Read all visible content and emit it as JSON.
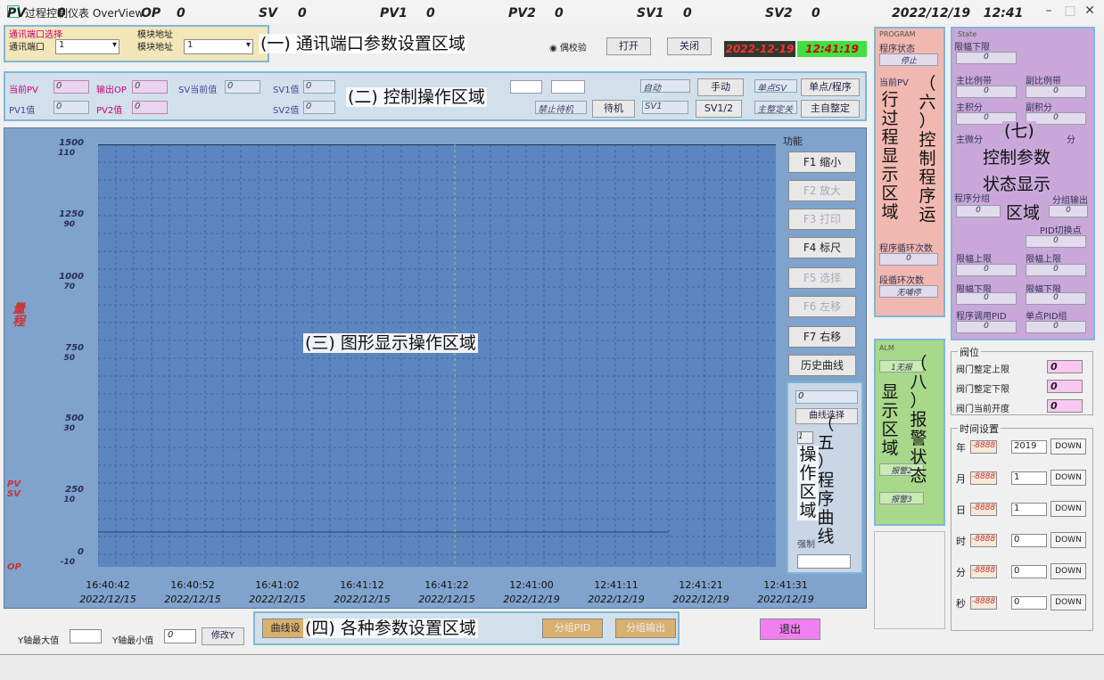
{
  "window": {
    "title": "过程控制仪表  OverView"
  },
  "region_labels": {
    "r1": "(一) 通讯端口参数设置区域",
    "r2": "(二) 控制操作区域",
    "r3": "(三) 图形显示操作区域",
    "r4": "(四) 各种参数设置区域",
    "r5": [
      "（",
      "五",
      "）",
      "程",
      "序",
      "曲",
      "线"
    ],
    "r5b": [
      "操",
      "作",
      "区",
      "域"
    ],
    "r6a": [
      "（",
      "六",
      "）",
      "控",
      "制",
      "程",
      "序",
      "运"
    ],
    "r6b": [
      "行",
      "过",
      "程",
      "显",
      "示",
      "区",
      "域"
    ],
    "r7a": "(七)",
    "r7b": "控制参数",
    "r7c": "状态显示",
    "r7d": "区域",
    "r8a": [
      "（",
      "八",
      "）",
      "报",
      "警",
      "状",
      "态"
    ],
    "r8b": [
      "显",
      "示",
      "区",
      "域"
    ]
  },
  "comm": {
    "port_group": "通讯端口选择",
    "port_label": "通讯端口",
    "port_value": "1",
    "addr_group": "模块地址",
    "addr_label": "模块地址",
    "addr_value": "1",
    "parity_option": "偶校验",
    "open_button": "打开",
    "close_button": "关闭",
    "date": "2022-12-19",
    "time": "12:41:19"
  },
  "control": {
    "pv_label": "当前PV",
    "pv_value": "0",
    "op_label": "输出OP",
    "op_value": "0",
    "sv_label": "SV当前值",
    "sv_value": "0",
    "sv1_label": "SV1值",
    "sv1_value": "0",
    "pv1_label": "PV1值",
    "pv1_value": "0",
    "pv2_label": "PV2值",
    "pv2_value": "0",
    "sv2_label": "SV2值",
    "sv2_value": "0",
    "mode_auto": "自动",
    "manual_button": "手动",
    "single_sv": "单点SV",
    "single_prog_button": "单点/程序",
    "disable_standby": "禁止待机",
    "standby_button": "待机",
    "sv1_tag": "SV1",
    "sv12_button": "SV1/2",
    "master_tune": "主整定关",
    "auto_tune_button": "主自整定"
  },
  "chart": {
    "yaxis_label": [
      "量",
      "程"
    ],
    "left_scale": [
      "1500",
      "1250",
      "1000",
      "750",
      "500",
      "250",
      "0"
    ],
    "right_scale": [
      "110",
      "90",
      "70",
      "50",
      "30",
      "10",
      "-10"
    ],
    "pv_label": "PV",
    "sv_label": "SV",
    "op_label": "OP",
    "x_times": [
      "16:40:42",
      "16:40:52",
      "16:41:02",
      "16:41:12",
      "16:41:22",
      "12:41:00",
      "12:41:11",
      "12:41:21",
      "12:41:31"
    ],
    "x_dates": [
      "2022/12/15",
      "2022/12/15",
      "2022/12/15",
      "2022/12/15",
      "2022/12/15",
      "2022/12/19",
      "2022/12/19",
      "2022/12/19",
      "2022/12/19"
    ]
  },
  "functions": {
    "group": "功能",
    "f1": "F1 缩小",
    "f2": "F2 放大",
    "f3": "F3 打印",
    "f4": "F4 标尺",
    "f5": "F5 选择",
    "f6": "F6 左移",
    "f7": "F7 右移",
    "history": "历史曲线"
  },
  "curve_panel": {
    "value": "0",
    "select_button": "曲线选择",
    "item1": "1",
    "force": "强制"
  },
  "bottom": {
    "ymax_label": "Y轴最大值",
    "ymin_label": "Y轴最小值",
    "ymin_value": "0",
    "modify_y": "修改Y",
    "curve_set": "曲线设",
    "group_pid": "分组PID",
    "group_out": "分组输出",
    "exit": "退出"
  },
  "program": {
    "header": "PROGRAM",
    "state_label": "程序状态",
    "state_value": "停止",
    "current_label": "当前PV",
    "loops_label": "程序循环次数",
    "loops_value": "0",
    "seg_loops_label": "段循环次数",
    "seg_loops_value": "无哺停"
  },
  "alarm": {
    "header": "ALM",
    "a1": "1无报",
    "a2": "报警2",
    "a3": "报警3"
  },
  "state": {
    "header": "State",
    "lower_limit": "限幅下限",
    "lower_value": "0",
    "p_main": "主比例带",
    "p_main_value": "0",
    "p_sub": "副比例带",
    "p_sub_value": "0",
    "i_main": "主积分",
    "i_main_value": "0",
    "i_sub": "副积分",
    "i_sub_value": "0",
    "d_main": "主微分",
    "d_sub": "分",
    "prog_seg": "程序分组",
    "seg_out": "分组输出",
    "pid_switch": "PID切换点",
    "pid_switch_value": "0",
    "upper1": "限幅上限",
    "upper2": "限幅上限",
    "lower1": "限幅下限",
    "lower2": "限幅下限",
    "prog_pid": "程序调用PID",
    "single_pid": "单点PID组",
    "zero": "0"
  },
  "valve": {
    "group": "阀位",
    "upper_label": "阀门整定上限",
    "upper_value": "0",
    "lower_label": "阀门整定下限",
    "lower_value": "0",
    "current_label": "阀门当前开度",
    "current_value": "0"
  },
  "time_set": {
    "group": "时间设置",
    "placeholder": "-8888",
    "down": "DOWN",
    "rows": [
      {
        "label": "年",
        "value": "2019"
      },
      {
        "label": "月",
        "value": "1"
      },
      {
        "label": "日",
        "value": "1"
      },
      {
        "label": "时",
        "value": "0"
      },
      {
        "label": "分",
        "value": "0"
      },
      {
        "label": "秒",
        "value": "0"
      }
    ]
  },
  "statusbar": {
    "pv": "PV",
    "pv_v": "0",
    "op": "OP",
    "op_v": "0",
    "sv": "SV",
    "sv_v": "0",
    "pv1": "PV1",
    "pv1_v": "0",
    "pv2": "PV2",
    "pv2_v": "0",
    "sv1": "SV1",
    "sv1_v": "0",
    "sv2": "SV2",
    "sv2_v": "0",
    "datetime": "2022/12/19   12:41"
  },
  "colors": {
    "plot_bg": "#5b86c0",
    "date_red": "#c00000",
    "time_green": "#40e040"
  }
}
